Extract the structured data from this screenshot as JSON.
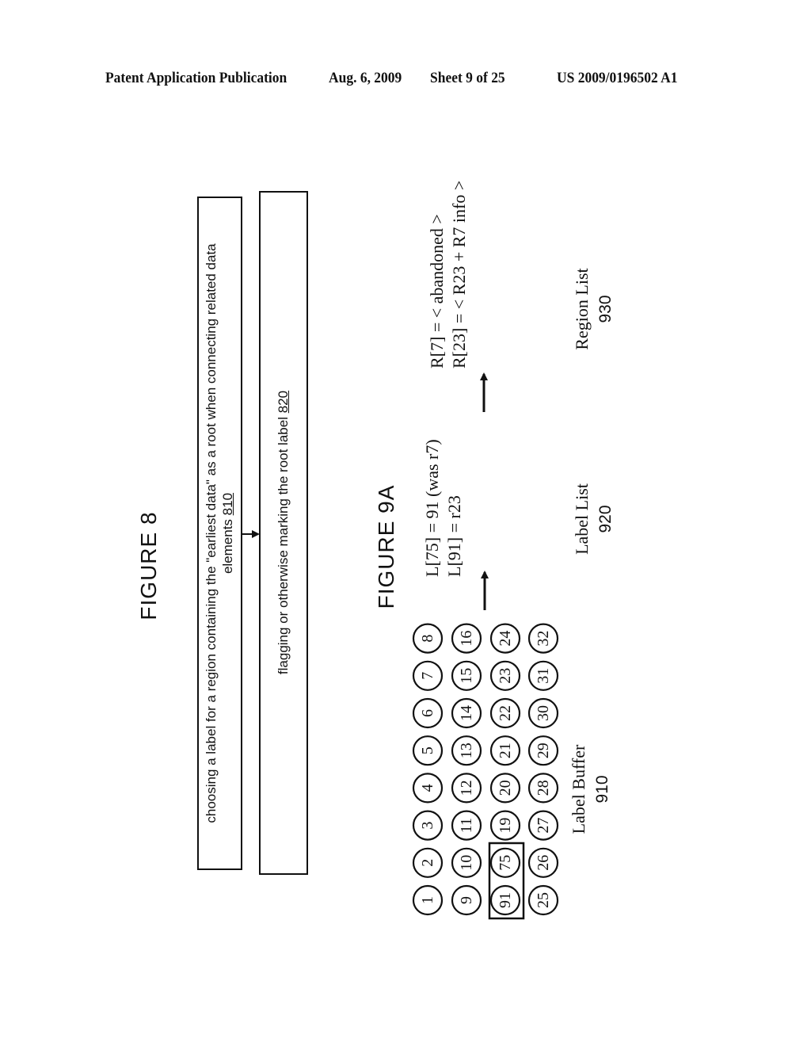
{
  "header": {
    "publication": "Patent Application Publication",
    "date": "Aug. 6, 2009",
    "sheet": "Sheet 9 of 25",
    "number": "US 2009/0196502 A1"
  },
  "figure8": {
    "title": "FIGURE 8",
    "steps": [
      {
        "text_line1": "choosing a label for a region containing the \"earliest data\" as a root when connecting related data",
        "text_line2": "elements",
        "ref": "810"
      },
      {
        "text_line1": "flagging or otherwise marking the root label",
        "ref": "820"
      }
    ]
  },
  "figure9a": {
    "title": "FIGURE 9A",
    "label_buffer": {
      "caption": "Label Buffer",
      "ref": "910",
      "rows": [
        [
          "1",
          "2",
          "3",
          "4",
          "5",
          "6",
          "7",
          "8"
        ],
        [
          "9",
          "10",
          "11",
          "12",
          "13",
          "14",
          "15",
          "16"
        ],
        [
          "91",
          "75",
          "19",
          "20",
          "21",
          "22",
          "23",
          "24"
        ],
        [
          "25",
          "26",
          "27",
          "28",
          "29",
          "30",
          "31",
          "32"
        ]
      ],
      "highlighted": [
        "91",
        "75"
      ]
    },
    "label_list": {
      "caption": "Label List",
      "ref": "920",
      "entries": [
        "L[75] = 91 (was r7)",
        "L[91] = r23"
      ]
    },
    "region_list": {
      "caption": "Region List",
      "ref": "930",
      "entries": [
        "R[7] = < abandoned >",
        "R[23] = < R23 + R7 info >"
      ]
    }
  }
}
